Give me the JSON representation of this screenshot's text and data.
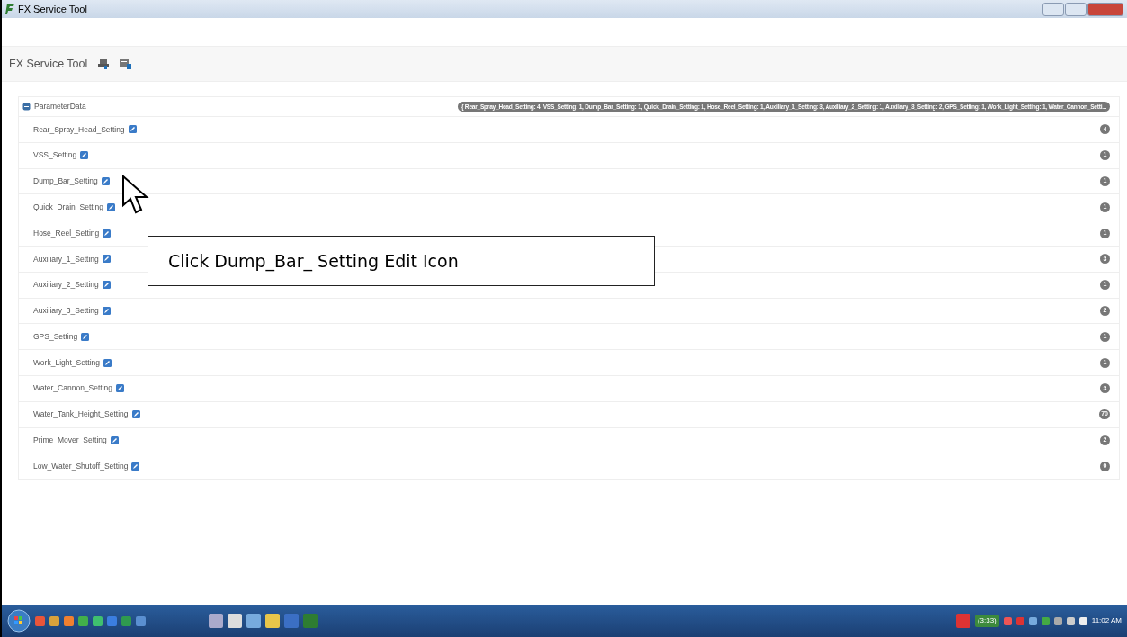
{
  "window": {
    "title": "FX Service Tool"
  },
  "header": {
    "title": "FX Service Tool"
  },
  "tree": {
    "root": {
      "label": "ParameterData",
      "expanded": true,
      "summary": "{ Rear_Spray_Head_Setting: 4, VSS_Setting: 1, Dump_Bar_Setting: 1, Quick_Drain_Setting: 1, Hose_Reel_Setting: 1, Auxiliary_1_Setting: 3, Auxiliary_2_Setting: 1, Auxiliary_3_Setting: 2, GPS_Setting: 1, Work_Light_Setting: 1, Water_Cannon_Setti..."
    },
    "children": [
      {
        "label": "Rear_Spray_Head_Setting",
        "count": "4"
      },
      {
        "label": "VSS_Setting",
        "count": "1"
      },
      {
        "label": "Dump_Bar_Setting",
        "count": "1"
      },
      {
        "label": "Quick_Drain_Setting",
        "count": "1"
      },
      {
        "label": "Hose_Reel_Setting",
        "count": "1"
      },
      {
        "label": "Auxiliary_1_Setting",
        "count": "3"
      },
      {
        "label": "Auxiliary_2_Setting",
        "count": "1"
      },
      {
        "label": "Auxiliary_3_Setting",
        "count": "2"
      },
      {
        "label": "GPS_Setting",
        "count": "1"
      },
      {
        "label": "Work_Light_Setting",
        "count": "1"
      },
      {
        "label": "Water_Cannon_Setting",
        "count": "3"
      },
      {
        "label": "Water_Tank_Height_Setting",
        "count": "70"
      },
      {
        "label": "Prime_Mover_Setting",
        "count": "2"
      },
      {
        "label": "Low_Water_Shutoff_Setting",
        "count": "0"
      }
    ]
  },
  "callout": {
    "text": "Click Dump_Bar_ Setting Edit Icon"
  },
  "taskbar": {
    "battery": "(3:33)",
    "clock": "11:02 AM"
  }
}
